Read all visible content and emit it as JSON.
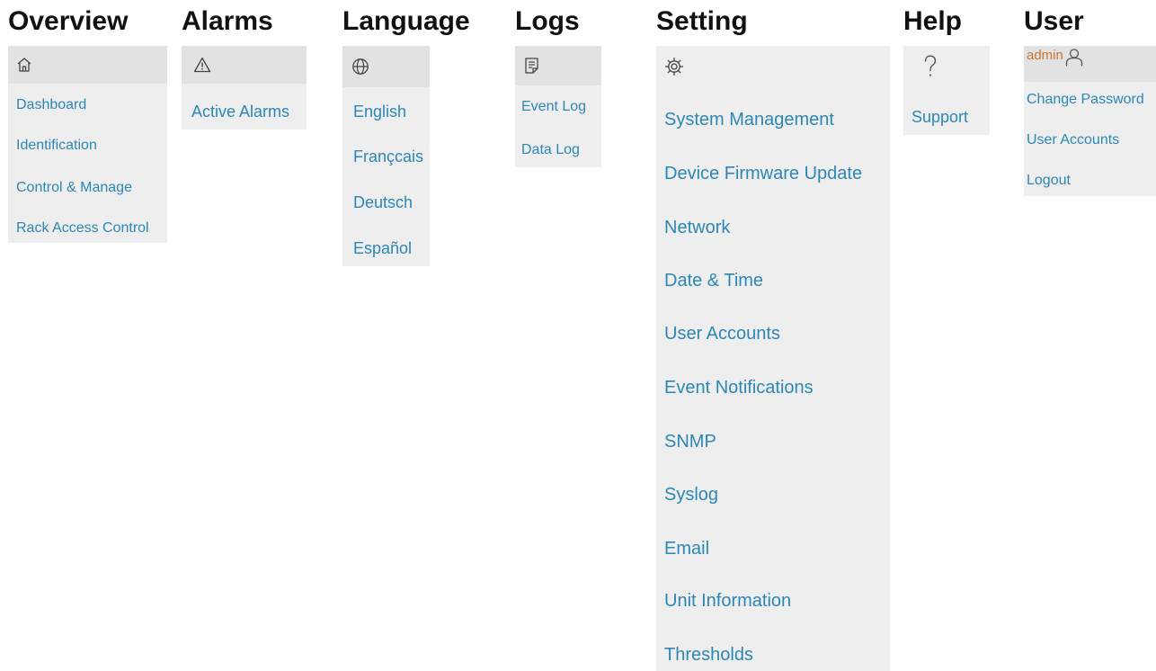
{
  "menus": {
    "overview": {
      "title": "Overview",
      "icon": "home-icon",
      "items": [
        "Dashboard",
        "Identification",
        "Control & Manage",
        "Rack Access Control"
      ]
    },
    "alarms": {
      "title": "Alarms",
      "icon": "warning-icon",
      "items": [
        "Active Alarms"
      ]
    },
    "language": {
      "title": "Language",
      "icon": "globe-icon",
      "items": [
        "English",
        "Françcais",
        "Deutsch",
        "Español"
      ]
    },
    "logs": {
      "title": "Logs",
      "icon": "log-document-icon",
      "items": [
        "Event Log",
        "Data Log"
      ]
    },
    "setting": {
      "title": "Setting",
      "icon": "gear-icon",
      "items": [
        "System Management",
        "Device Firmware Update",
        "Network",
        "Date & Time",
        "User Accounts",
        "Event Notifications",
        "SNMP",
        "Syslog",
        "Email",
        "Unit Information",
        "Thresholds"
      ]
    },
    "help": {
      "title": "Help",
      "icon": "question-icon",
      "items": [
        "Support"
      ]
    },
    "user": {
      "title": "User",
      "icon": "user-icon",
      "username": "admin",
      "items": [
        "Change Password",
        "User Accounts",
        "Logout"
      ]
    }
  },
  "colors": {
    "link": "#2c87b6",
    "panel": "#eeeeee",
    "icon_bar": "#e2e2e2",
    "title": "#111111",
    "username": "#c87533"
  }
}
